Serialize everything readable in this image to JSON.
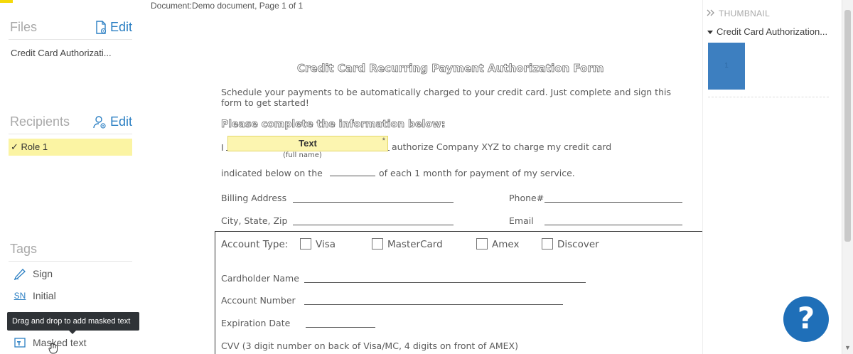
{
  "document": {
    "title": "Document:Demo document, Page 1 of 1"
  },
  "sidebar": {
    "files": {
      "title": "Files",
      "edit_label": "Edit",
      "items": [
        "Credit Card Authorizati..."
      ]
    },
    "recipients": {
      "title": "Recipients",
      "edit_label": "Edit",
      "items": [
        "✓ Role 1"
      ]
    },
    "tags": {
      "title": "Tags",
      "items": [
        {
          "label": "Sign",
          "icon": "pen-icon"
        },
        {
          "label": "Initial",
          "icon": "SN"
        },
        {
          "label": "Masked text",
          "icon": "masked-text-icon"
        }
      ],
      "tooltip": "Drag and drop to add masked text"
    }
  },
  "form": {
    "heading": "Credit Card Recurring Payment Authorization Form",
    "intro_line1": "Schedule your payments to be automatically charged to your credit card.  Just complete and sign this",
    "intro_line2": "form to get started!",
    "subheading": "Please complete the information below:",
    "i_label": "I",
    "text_field_label": "Text",
    "text_field_required": "*",
    "full_name_caption": "(full name)",
    "authorize_text": "authorize Company XYZ to charge my credit card",
    "indicated_text": "indicated below on the",
    "each_month_text": "of each 1 month for payment of my service.",
    "billing_address_label": "Billing Address",
    "phone_label": "Phone#",
    "city_label": "City, State, Zip",
    "email_label": "Email",
    "account_type_label": "Account Type:",
    "card_types": [
      "Visa",
      "MasterCard",
      "Amex",
      "Discover"
    ],
    "cardholder_label": "Cardholder Name",
    "account_number_label": "Account Number",
    "expiration_label": "Expiration Date",
    "cvv_label": "CVV (3 digit number on back of Visa/MC, 4 digits on front of AMEX)"
  },
  "right_panel": {
    "header": "THUMBNAIL",
    "doc_name": "Credit Card Authorization...",
    "page_number": "1"
  },
  "help": {
    "label": "?"
  },
  "colors": {
    "accent": "#2b7fc3",
    "highlight": "#fbf4a3",
    "help": "#1f6fb8"
  }
}
